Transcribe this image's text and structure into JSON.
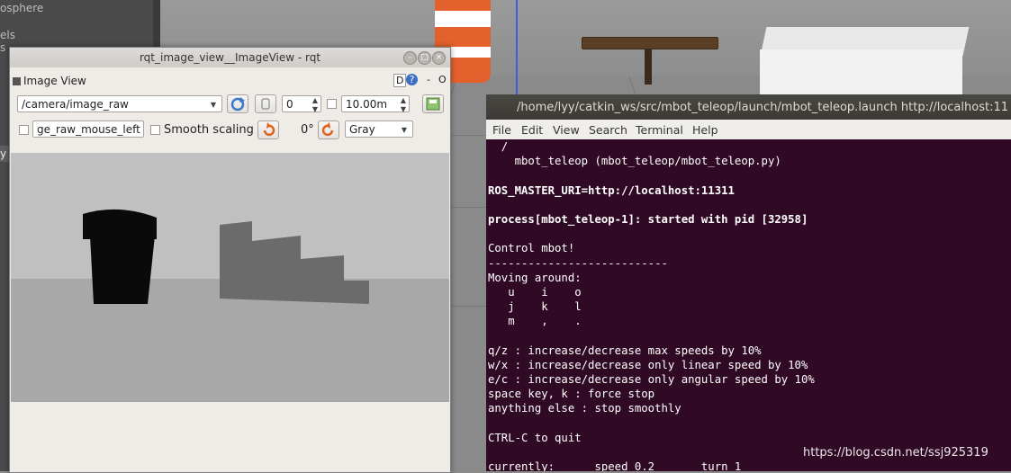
{
  "gazebo": {
    "left_panel_items": [
      "osphere",
      "els",
      "s",
      "y"
    ]
  },
  "rqt": {
    "window_title": "rqt_image_view__ImageView - rqt",
    "plugin_title": "Image View",
    "help_d": "D",
    "help_q": "?",
    "dash": "-",
    "close_o": "O",
    "topic_value": "/camera/image_raw",
    "spin_value": "0",
    "distance_value": "10.00m",
    "mouse_topic_value": "ge_raw_mouse_left",
    "smooth_label": "Smooth scaling",
    "rotation_label": "0°",
    "color_scheme_value": "Gray"
  },
  "terminal": {
    "title": "/home/lyy/catkin_ws/src/mbot_teleop/launch/mbot_teleop.launch http://localhost:11",
    "menu": [
      "File",
      "Edit",
      "View",
      "Search",
      "Terminal",
      "Help"
    ],
    "lines": [
      "  /",
      "    mbot_teleop (mbot_teleop/mbot_teleop.py)",
      "",
      "ROS_MASTER_URI=http://localhost:11311",
      "",
      "process[mbot_teleop-1]: started with pid [32958]",
      "",
      "Control mbot!",
      "---------------------------",
      "Moving around:",
      "   u    i    o",
      "   j    k    l",
      "   m    ,    .",
      "",
      "q/z : increase/decrease max speeds by 10%",
      "w/x : increase/decrease only linear speed by 10%",
      "e/c : increase/decrease only angular speed by 10%",
      "space key, k : force stop",
      "anything else : stop smoothly",
      "",
      "CTRL-C to quit",
      "",
      "currently:      speed 0.2       turn 1"
    ]
  },
  "watermark": "https://blog.csdn.net/ssj925319",
  "colors": {
    "terminal_bg": "#300a24",
    "cone_orange": "#e4602c",
    "axis_blue": "#3b5de8"
  }
}
